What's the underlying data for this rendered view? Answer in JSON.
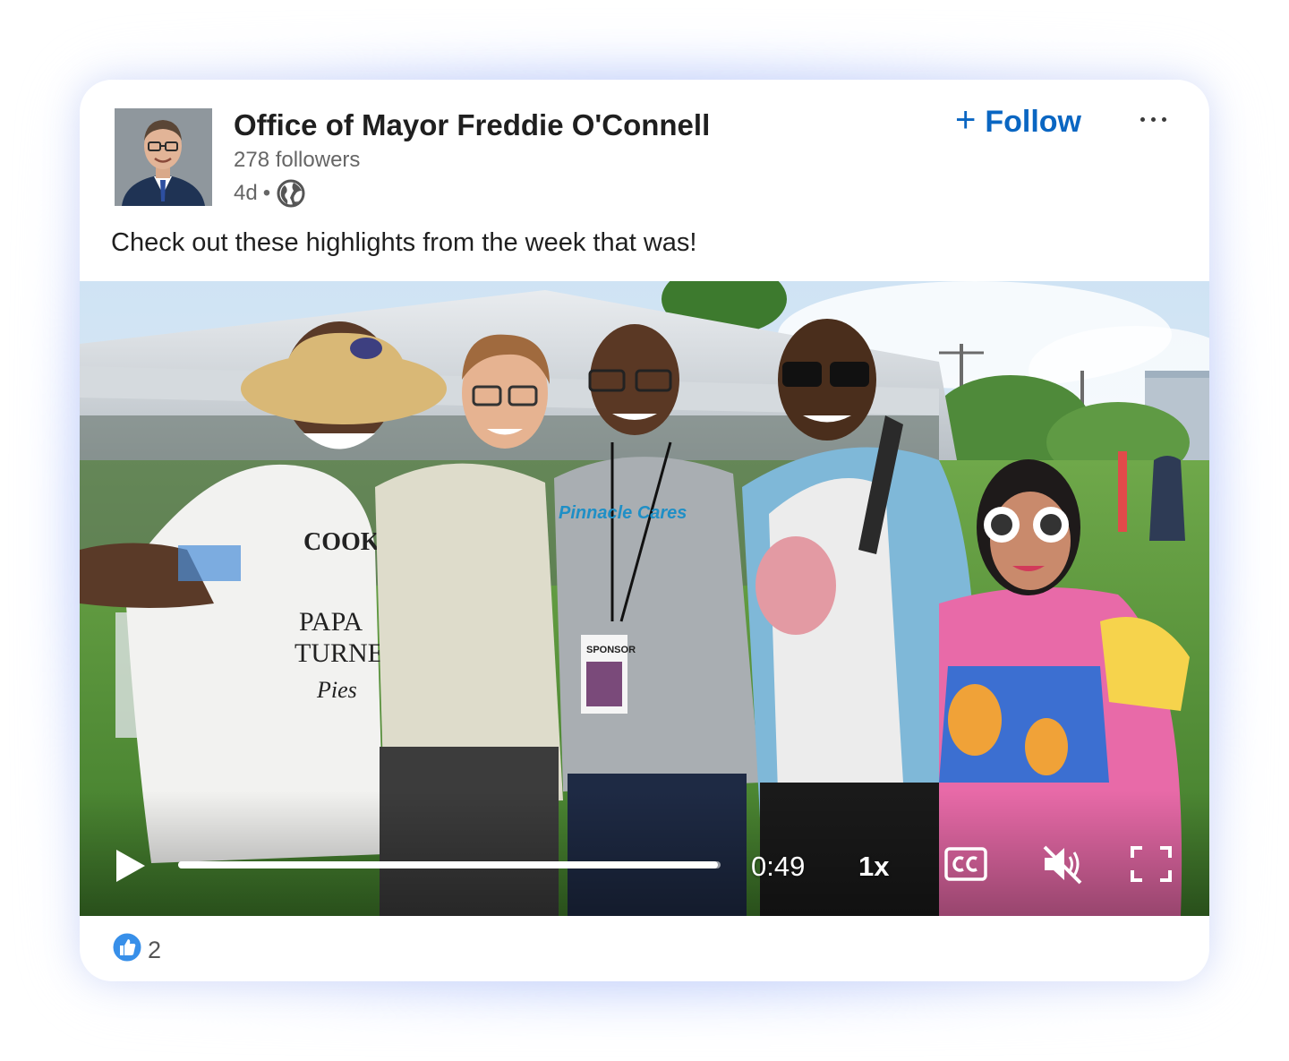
{
  "post": {
    "author_name": "Office of Mayor Freddie O'Connell",
    "followers": "278 followers",
    "time_ago": "4d",
    "separator": "•",
    "visibility_icon": "globe-icon",
    "follow_label": "Follow",
    "follow_icon": "plus-icon",
    "more_icon": "more-dots-icon",
    "text": "Check out these highlights from the week that was!"
  },
  "video": {
    "play_icon": "play-icon",
    "progress_fraction": 0.995,
    "time": "0:49",
    "speed": "1x",
    "cc_label": "CC",
    "mute_icon": "volume-muted-icon",
    "fullscreen_icon": "fullscreen-icon"
  },
  "reactions": {
    "icon": "like-icon",
    "count": "2"
  },
  "colors": {
    "accent": "#0a66c2",
    "text_primary": "#1f1f1f",
    "text_secondary": "#666666"
  }
}
